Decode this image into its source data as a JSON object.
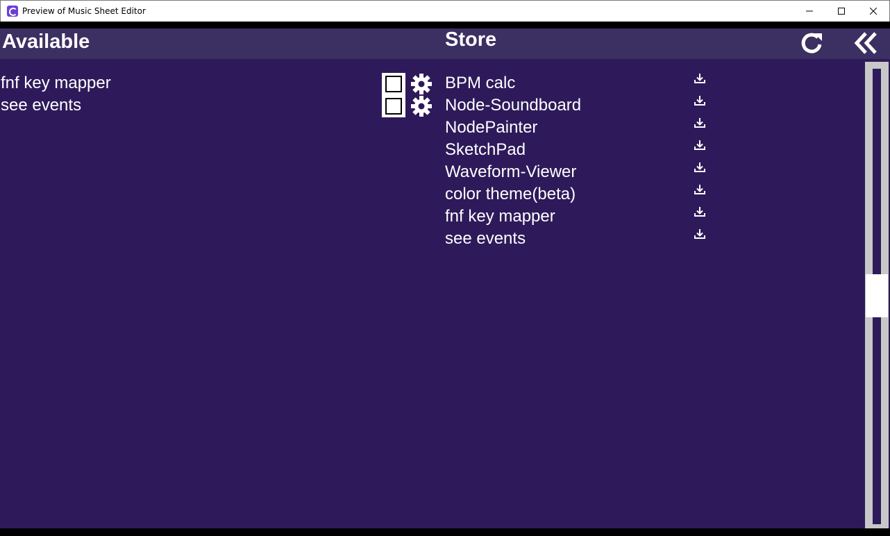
{
  "window": {
    "title": "Preview of Music Sheet Editor"
  },
  "header": {
    "available_title": "Available",
    "store_title": "Store"
  },
  "available": {
    "items": [
      {
        "label": "fnf key mapper",
        "enabled": false
      },
      {
        "label": "see events",
        "enabled": false
      }
    ]
  },
  "store": {
    "items": [
      {
        "label": "BPM calc"
      },
      {
        "label": "Node-Soundboard"
      },
      {
        "label": "NodePainter"
      },
      {
        "label": "SketchPad"
      },
      {
        "label": "Waveform-Viewer"
      },
      {
        "label": "color theme(beta)"
      },
      {
        "label": "fnf key mapper"
      },
      {
        "label": "see events"
      }
    ]
  },
  "colors": {
    "background": "#2e1a5a",
    "header": "#3c2f62",
    "text": "#ffffff"
  },
  "icons": {
    "refresh": "refresh-icon",
    "collapse": "double-chevron-left-icon",
    "settings": "gear-icon",
    "download": "download-icon"
  }
}
